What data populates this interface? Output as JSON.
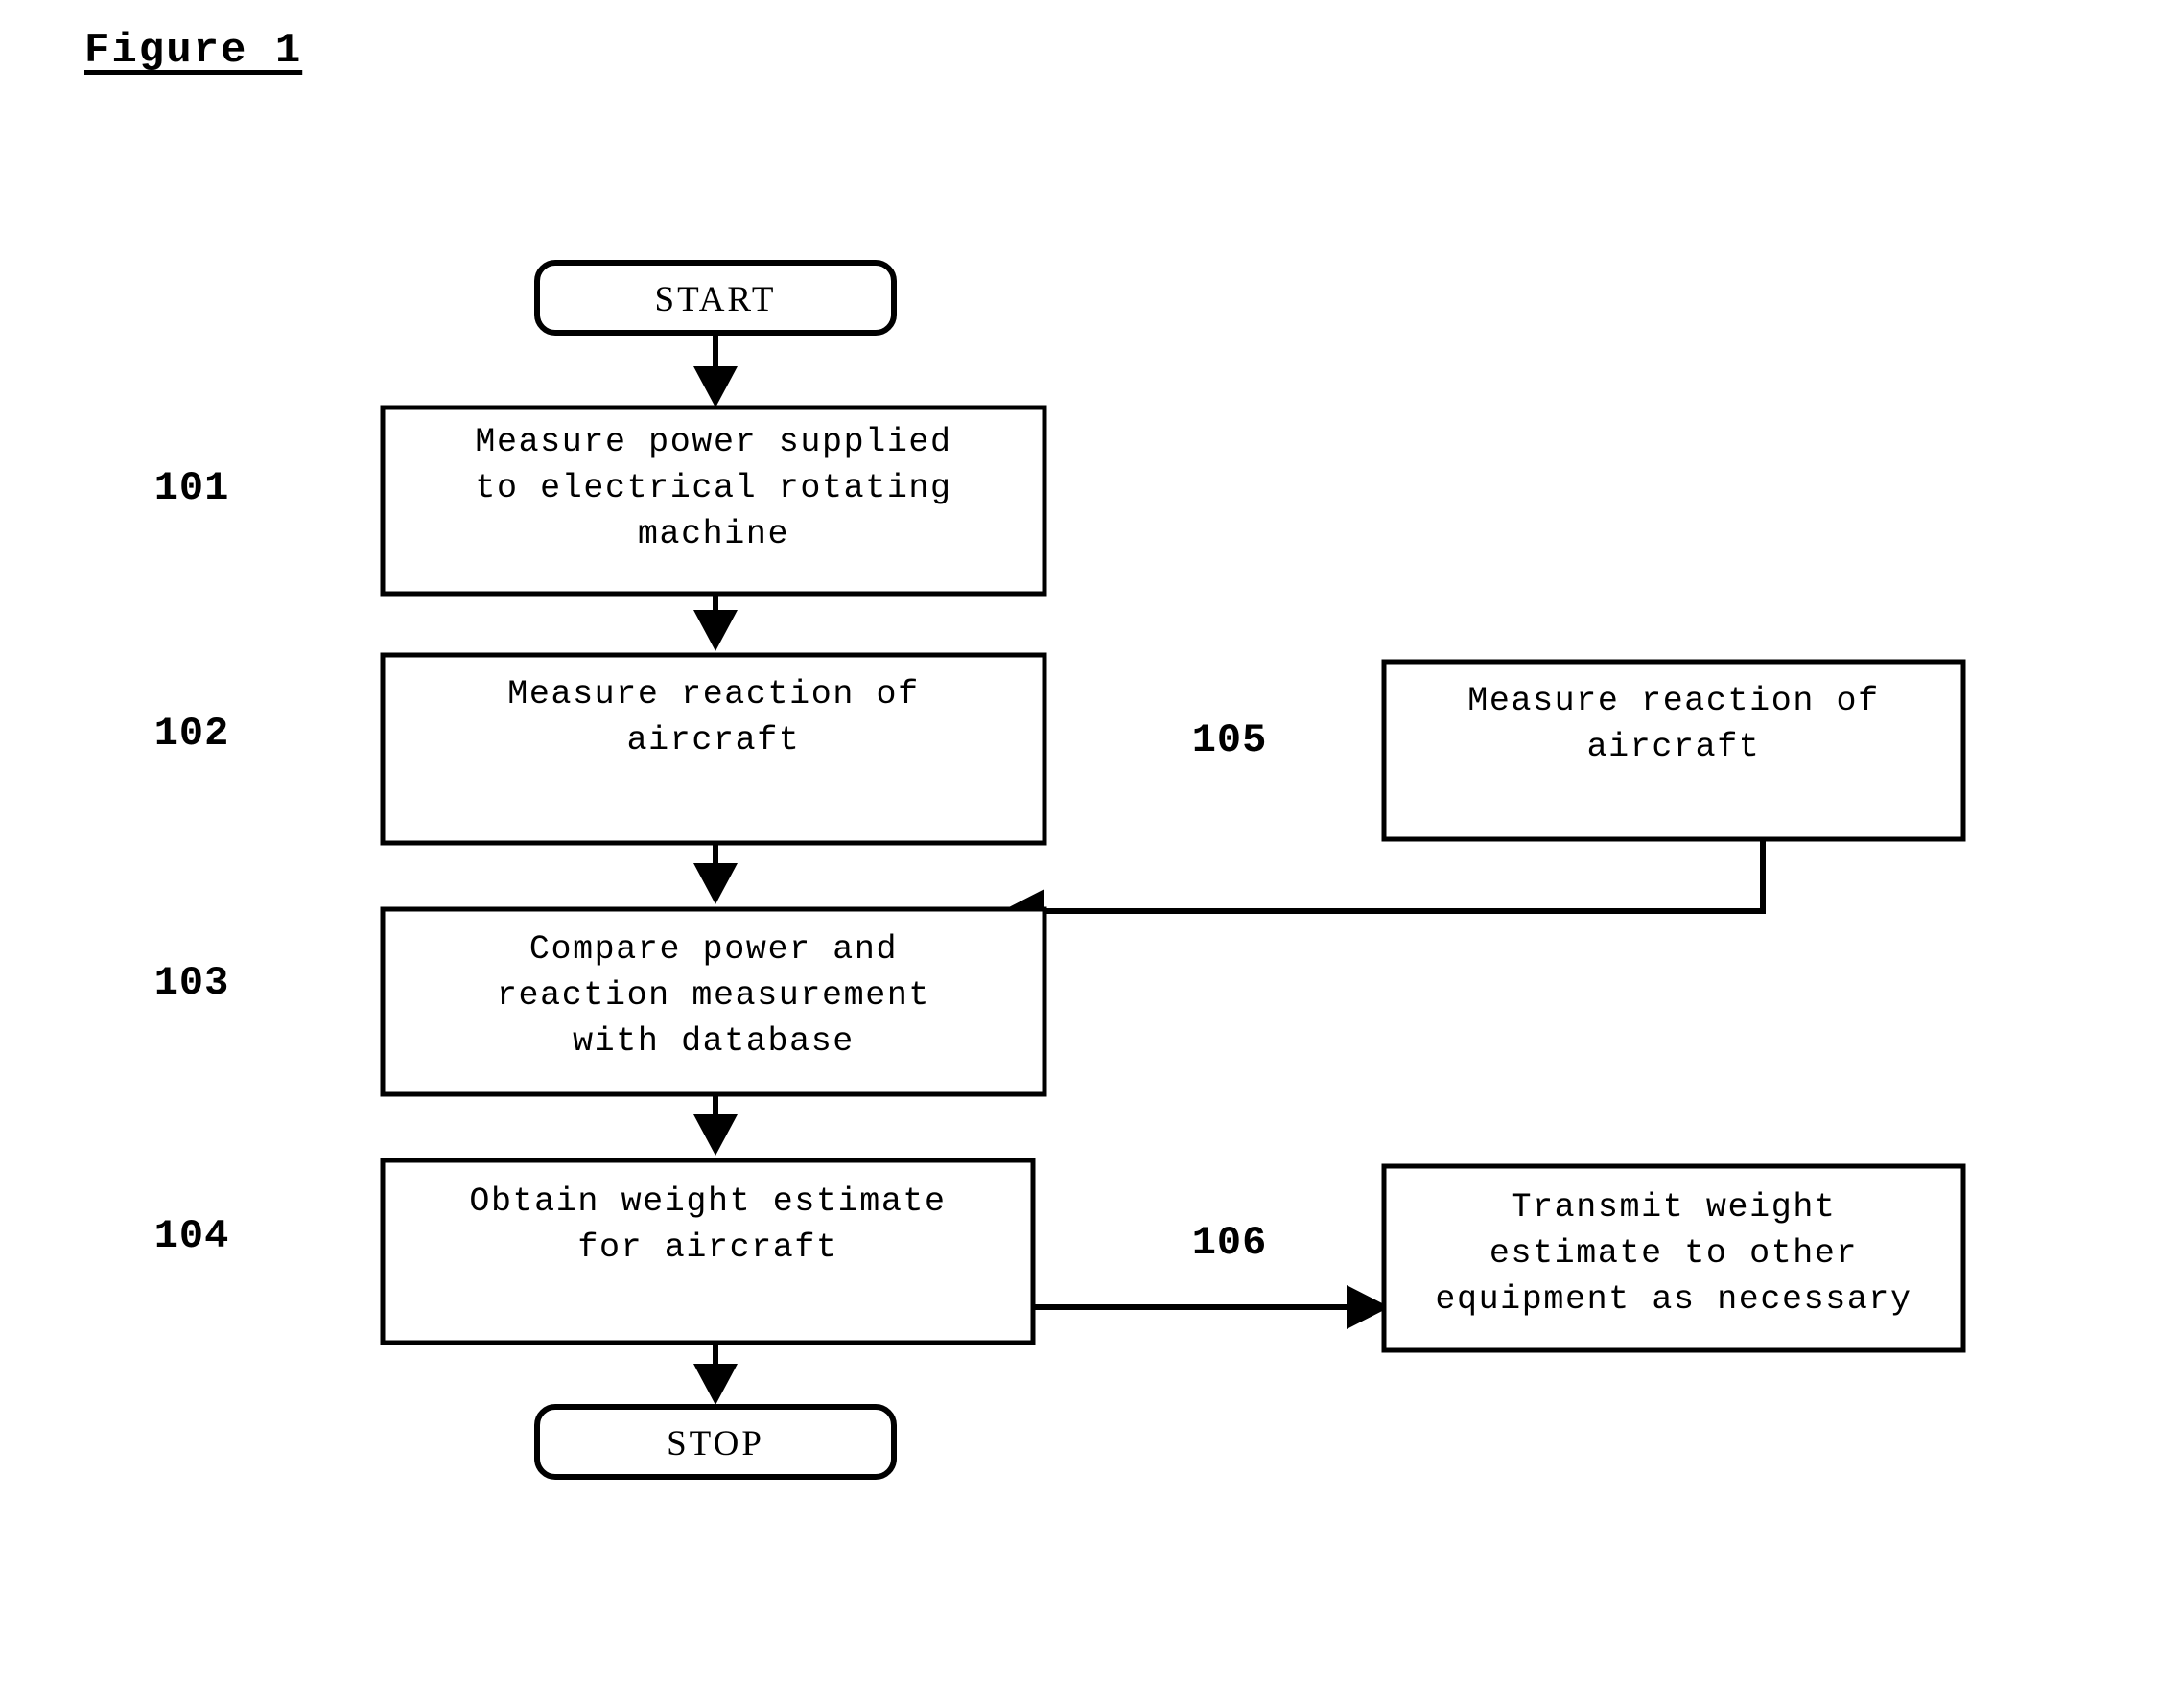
{
  "figure": {
    "title": "Figure 1"
  },
  "terminators": {
    "start": {
      "label": "START"
    },
    "stop": {
      "label": "STOP"
    }
  },
  "steps": [
    {
      "ref": "101",
      "lines": [
        "Measure power supplied",
        "to electrical rotating",
        "machine"
      ]
    },
    {
      "ref": "102",
      "lines": [
        "Measure reaction of",
        "aircraft"
      ]
    },
    {
      "ref": "103",
      "lines": [
        "Compare power and",
        "reaction measurement",
        "with database"
      ]
    },
    {
      "ref": "104",
      "lines": [
        "Obtain weight estimate",
        "for aircraft"
      ]
    },
    {
      "ref": "105",
      "lines": [
        "Measure reaction of",
        "aircraft"
      ]
    },
    {
      "ref": "106",
      "lines": [
        "Transmit weight",
        "estimate to other",
        "equipment as necessary"
      ]
    }
  ],
  "chart_data": {
    "type": "diagram",
    "title": "Figure 1",
    "nodes": [
      {
        "id": "start",
        "shape": "rounded-rectangle",
        "text": "START"
      },
      {
        "id": "101",
        "shape": "rectangle",
        "text": "Measure power supplied to electrical rotating machine"
      },
      {
        "id": "102",
        "shape": "rectangle",
        "text": "Measure reaction of aircraft"
      },
      {
        "id": "103",
        "shape": "rectangle",
        "text": "Compare power and reaction measurement with database"
      },
      {
        "id": "104",
        "shape": "rectangle",
        "text": "Obtain weight estimate for aircraft"
      },
      {
        "id": "105",
        "shape": "rectangle",
        "text": "Measure reaction of aircraft"
      },
      {
        "id": "106",
        "shape": "rectangle",
        "text": "Transmit weight estimate to other equipment as necessary"
      },
      {
        "id": "stop",
        "shape": "rounded-rectangle",
        "text": "STOP"
      }
    ],
    "edges": [
      {
        "from": "start",
        "to": "101",
        "style": "arrow"
      },
      {
        "from": "101",
        "to": "102",
        "style": "arrow"
      },
      {
        "from": "102",
        "to": "103",
        "style": "arrow"
      },
      {
        "from": "105",
        "to": "103",
        "style": "arrow"
      },
      {
        "from": "103",
        "to": "104",
        "style": "arrow"
      },
      {
        "from": "104",
        "to": "106",
        "style": "arrow"
      },
      {
        "from": "104",
        "to": "stop",
        "style": "arrow"
      }
    ],
    "colors": {
      "line": "#000000",
      "fill": "#ffffff",
      "text": "#000000"
    }
  }
}
